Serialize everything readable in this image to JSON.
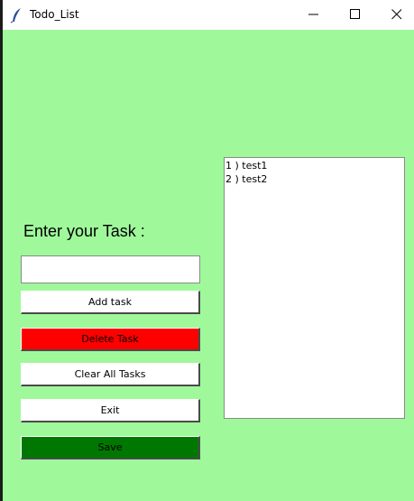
{
  "window": {
    "title": "Todo_List"
  },
  "colors": {
    "background": "#9ff99b",
    "delete_button": "#ff0000",
    "save_button": "#007700"
  },
  "form": {
    "prompt": "Enter your Task :",
    "input_value": ""
  },
  "buttons": {
    "add": "Add task",
    "delete": "Delete Task",
    "clear": "Clear All Tasks",
    "exit": "Exit",
    "save": "Save"
  },
  "tasks": [
    "1 ) test1",
    "2 ) test2"
  ]
}
